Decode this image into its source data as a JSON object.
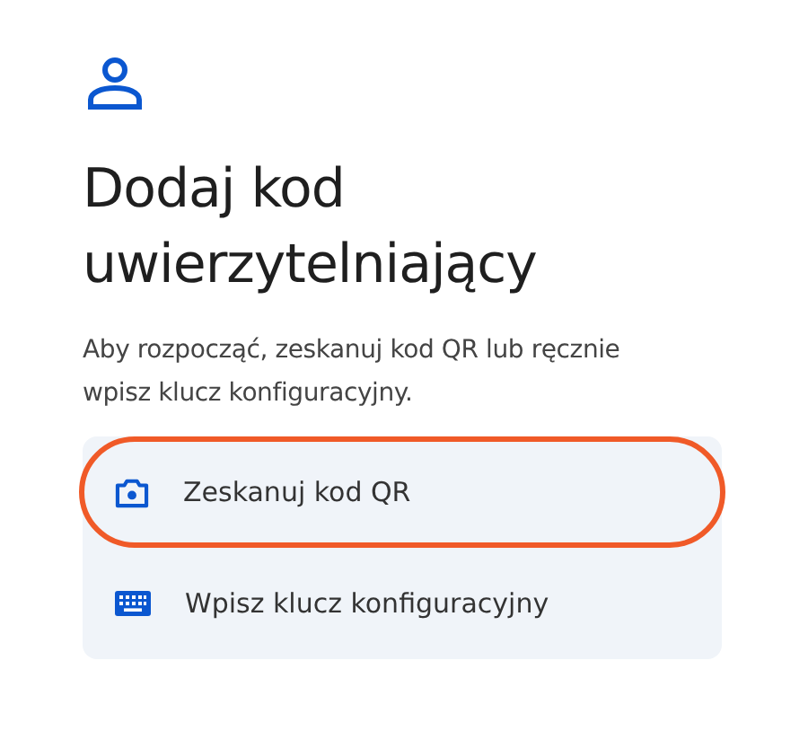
{
  "title": "Dodaj kod uwierzytelniający",
  "description": "Aby rozpocząć, zeskanuj kod QR lub ręcznie wpisz klucz konfiguracyjny.",
  "options": [
    {
      "kind": "camera",
      "label": "Zeskanuj kod QR",
      "highlighted": true
    },
    {
      "kind": "keyboard",
      "label": "Wpisz klucz konfiguracyjny",
      "highlighted": false
    }
  ]
}
